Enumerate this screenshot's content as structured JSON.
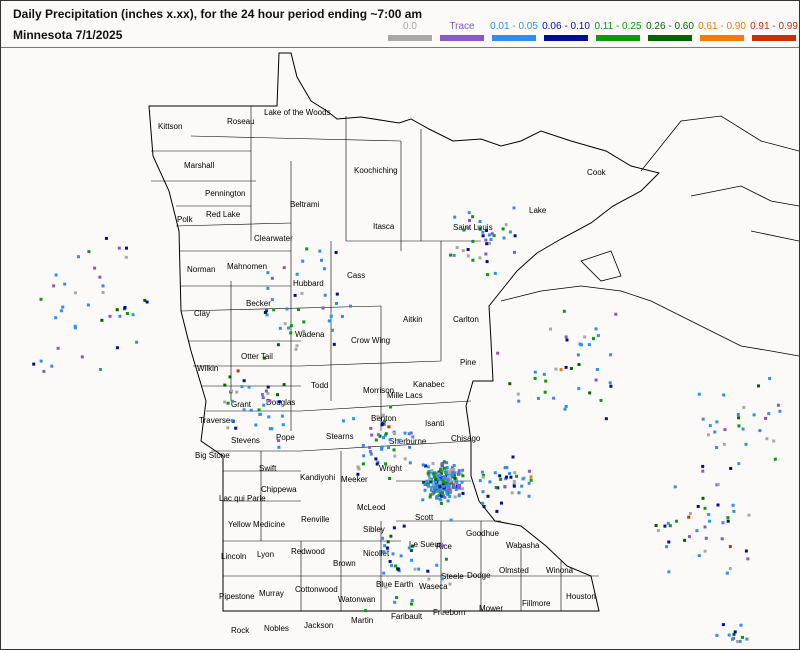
{
  "header": {
    "title": "Daily Precipitation (inches  x.xx),  for the 24 hour period ending ~7:00 am",
    "subtitle": "Minnesota 7/1/2025"
  },
  "legend": [
    {
      "label": "0.0",
      "color": "#a8a8a8"
    },
    {
      "label": "Trace",
      "color": "#8a56c8"
    },
    {
      "label": "0.01 - 0.05",
      "color": "#2e8ff0"
    },
    {
      "label": "0.06 - 0.10",
      "color": "#000f96"
    },
    {
      "label": "0.11 - 0.25",
      "color": "#0a9a0a"
    },
    {
      "label": "0.26 - 0.60",
      "color": "#006400"
    },
    {
      "label": "0.61 - 0.90",
      "color": "#f57a00"
    },
    {
      "label": "0.91 - 0.99",
      "color": "#c83200"
    }
  ],
  "counties": [
    "Kittson",
    "Roseau",
    "Lake of the Woods",
    "Marshall",
    "Koochiching",
    "Pennington",
    "Red Lake",
    "Polk",
    "Beltrami",
    "Cook",
    "Lake",
    "Saint Louis",
    "Itasca",
    "Clearwater",
    "Norman",
    "Mahnomen",
    "Cass",
    "Hubbard",
    "Clay",
    "Becker",
    "Wadena",
    "Crow Wing",
    "Aitkin",
    "Carlton",
    "Wilkin",
    "Otter Tail",
    "Pine",
    "Todd",
    "Morrison",
    "Mille Lacs",
    "Kanabec",
    "Grant",
    "Douglas",
    "Traverse",
    "Stevens",
    "Pope",
    "Stearns",
    "Benton",
    "Sherburne",
    "Isanti",
    "Chisago",
    "Big Stone",
    "Swift",
    "Kandiyohi",
    "Meeker",
    "Wright",
    "Chippewa",
    "Lac qui Parle",
    "Renville",
    "McLeod",
    "Yellow Medicine",
    "Sibley",
    "Scott",
    "Goodhue",
    "Rice",
    "Wabasha",
    "Lincoln",
    "Lyon",
    "Redwood",
    "Nicollet",
    "Le Sueur",
    "Brown",
    "Steele",
    "Dodge",
    "Olmsted",
    "Winona",
    "Blue Earth",
    "Waseca",
    "Pipestone",
    "Murray",
    "Cottonwood",
    "Watonwan",
    "Faribault",
    "Freeborn",
    "Mower",
    "Fillmore",
    "Houston",
    "Rock",
    "Nobles",
    "Jackson",
    "Martin"
  ]
}
